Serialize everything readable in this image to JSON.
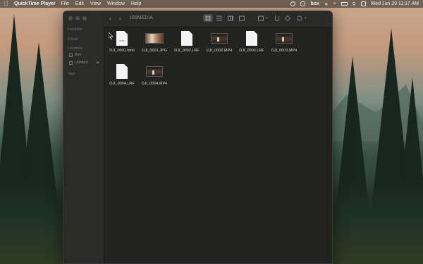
{
  "menubar": {
    "app_name": "QuickTime Player",
    "menus": [
      "File",
      "Edit",
      "View",
      "Window",
      "Help"
    ],
    "status_text": "box",
    "datetime": "Wed Jun 29  11:17 AM"
  },
  "window": {
    "title": "100MEDIA",
    "sidebar": {
      "favorites_label": "Favorites",
      "icloud_label": "iCloud",
      "locations_label": "Locations",
      "locations": [
        "Box",
        "Untitled"
      ],
      "tags_label": "Tags"
    },
    "files": [
      {
        "name": "DJI_0001.html",
        "kind": "doc",
        "ext": "HTML"
      },
      {
        "name": "DJI_0001.JPG",
        "kind": "photo"
      },
      {
        "name": "DJI_0002.LRF",
        "kind": "doc",
        "ext": ""
      },
      {
        "name": "DJI_0002.MP4",
        "kind": "video"
      },
      {
        "name": "DJI_0003.LRF",
        "kind": "doc",
        "ext": ""
      },
      {
        "name": "DJI_0003.MP4",
        "kind": "video"
      },
      {
        "name": "DJI_0004.LRF",
        "kind": "doc",
        "ext": ""
      },
      {
        "name": "DJI_0004.MP4",
        "kind": "video"
      }
    ]
  },
  "icons": [
    "apple-icon",
    "wifi-icon",
    "bluetooth-icon",
    "control-center-icon",
    "spotlight-icon",
    "battery-icon"
  ]
}
